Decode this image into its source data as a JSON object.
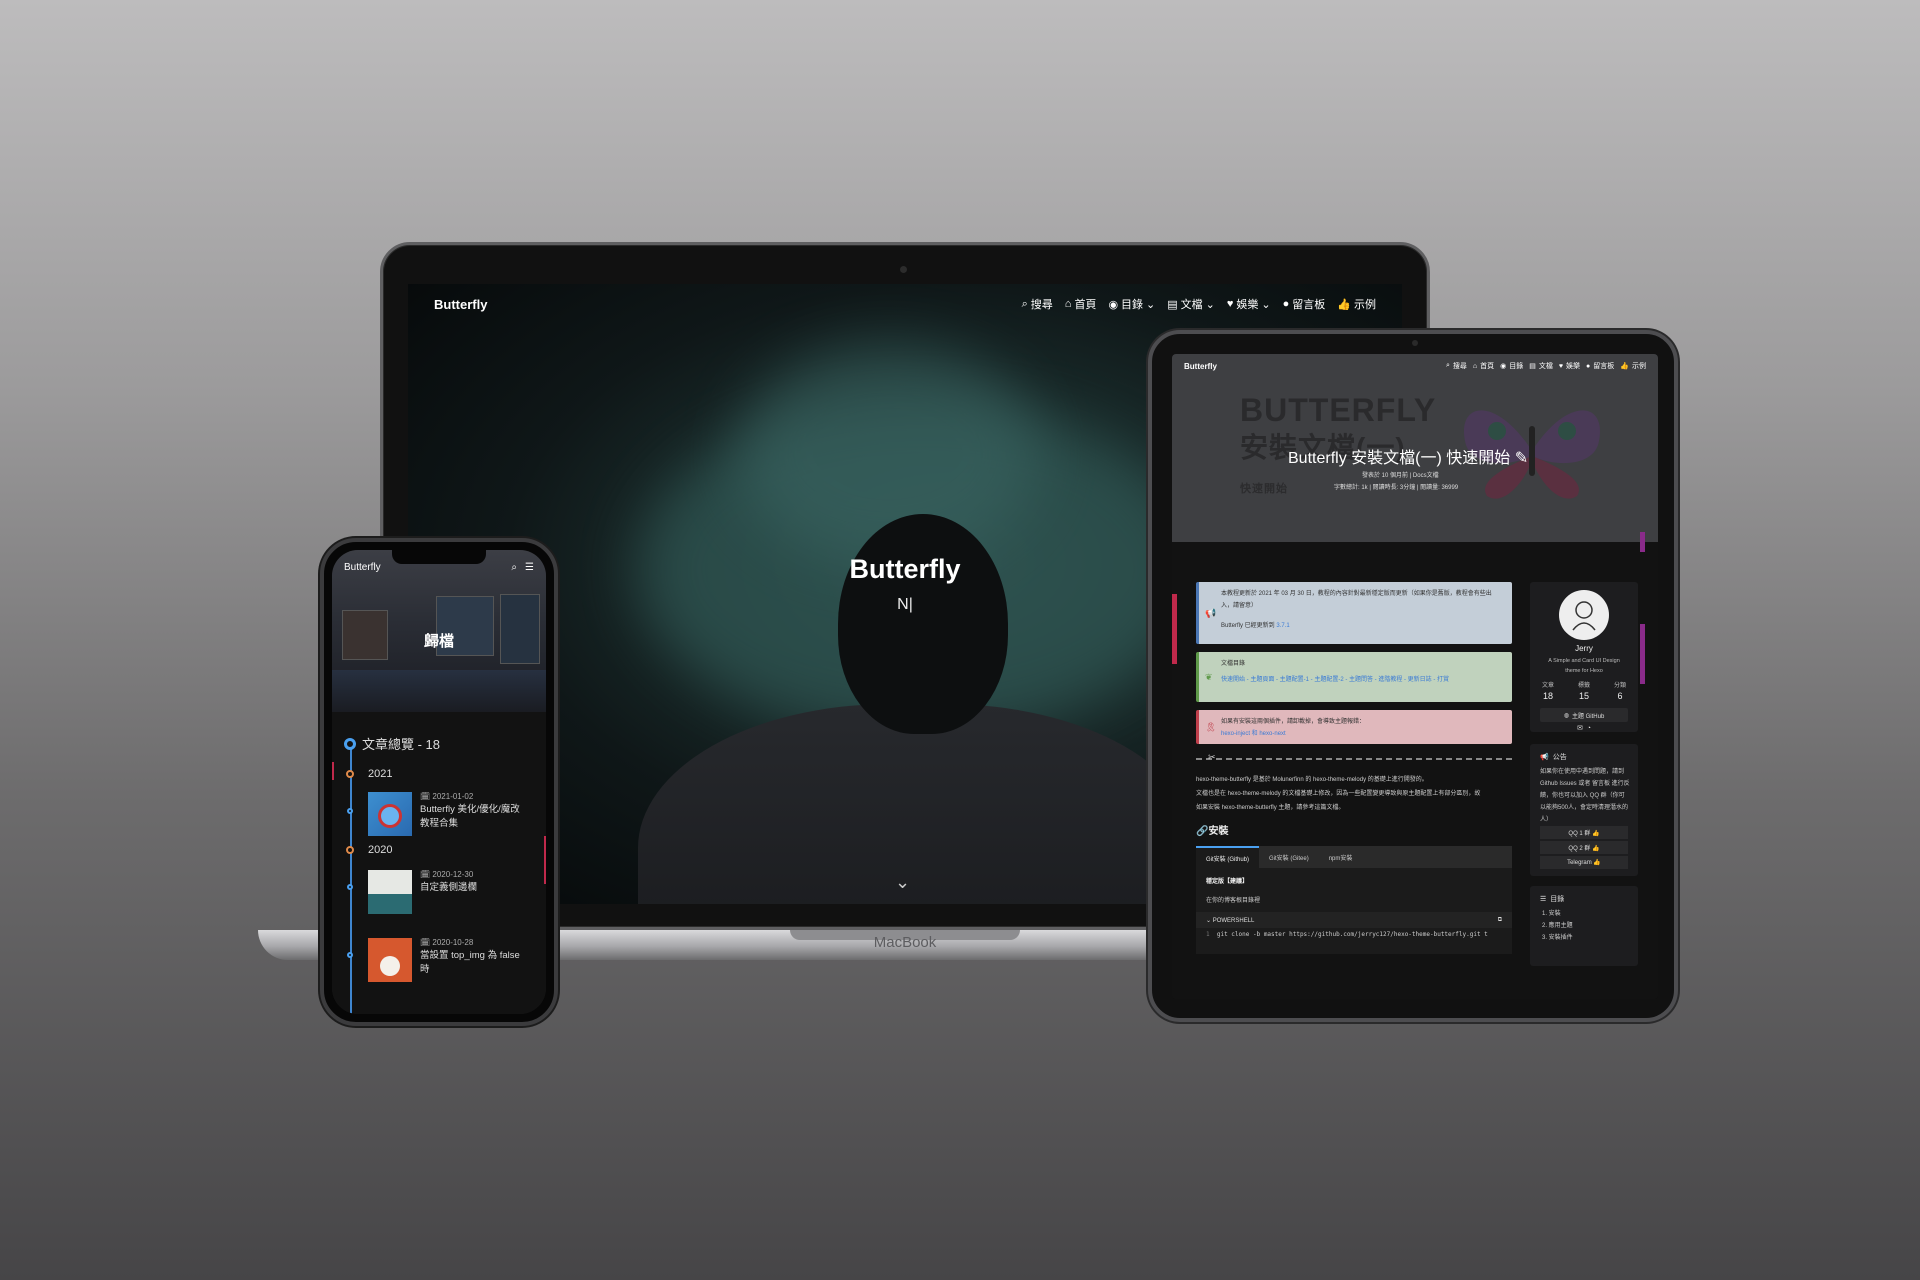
{
  "laptop": {
    "brand": "Butterfly",
    "nav": [
      {
        "icon": "search-icon",
        "glyph": "⌕",
        "label": "搜尋"
      },
      {
        "icon": "home-icon",
        "glyph": "⌂",
        "label": "首頁"
      },
      {
        "icon": "compass-icon",
        "glyph": "◉",
        "label": "目錄"
      },
      {
        "icon": "book-icon",
        "glyph": "▤",
        "label": "文檔"
      },
      {
        "icon": "heart-icon",
        "glyph": "♥",
        "label": "娛樂"
      },
      {
        "icon": "comment-icon",
        "glyph": "●",
        "label": "留言板"
      },
      {
        "icon": "thumbs-up-icon",
        "glyph": "👍",
        "label": "示例"
      }
    ],
    "site_title": "Butterfly",
    "subtitle": "N|",
    "base_label": "MacBook"
  },
  "phone": {
    "brand": "Butterfly",
    "page_title": "歸檔",
    "archive_header": "文章總覽 - 18",
    "years": [
      "2021",
      "2020"
    ],
    "posts": [
      {
        "date": "2021-01-02",
        "title": "Butterfly 美化/優化/魔改教程合集"
      },
      {
        "date": "2020-12-30",
        "title": "自定義側邊欄"
      },
      {
        "date": "2020-10-28",
        "title": "當設置 top_img 為 false 時"
      }
    ]
  },
  "tablet": {
    "brand": "Butterfly",
    "nav": [
      {
        "label": "搜尋"
      },
      {
        "label": "首頁"
      },
      {
        "label": "目錄"
      },
      {
        "label": "文檔"
      },
      {
        "label": "娛樂"
      },
      {
        "label": "留言板"
      },
      {
        "label": "示例"
      }
    ],
    "bg_title_1": "BUTTERFLY",
    "bg_title_2": "安裝文檔(一)",
    "bg_title_3": "快速開始",
    "post_title": "Butterfly 安裝文檔(一) 快速開始",
    "meta_1": "發表於 10 個月前 | Docs文檔",
    "meta_2": "字數總計: 1k | 閱讀時長: 3分鐘 | 閱讀量: 36999",
    "note_blue_1": "本教程更新於 2021 年 03 月 30 日，教程的內容針對最新穩定版而更新（如果你是舊版，教程會有些出入，請留意）",
    "note_blue_2": "Butterfly 已經更新到",
    "note_blue_version": "3.7.1",
    "note_green_head": "文檔目錄",
    "note_green_links": "快速開始 - 主題頁面 - 主題配置-1 - 主題配置-2 - 主題問答 - 進階教程 - 更新日誌 - 打賞",
    "note_red_1": "如果有安裝這兩個插件，請卸載掉，會導致主題報錯：",
    "note_red_2": "hexo-inject 和 hexo-next",
    "para_1": "hexo-theme-butterfly 是基於 Molunerfinn 的 hexo-theme-melody 的基礎上進行開發的。",
    "para_2": "文檔也是在 hexo-theme-melody 的文檔基礎上修改，因為一些配置變更導致與原主題配置上有部分區別，故",
    "para_3": "如果安裝 hexo-theme-butterfly 主題，請參考這篇文檔。",
    "install_heading": "安裝",
    "tabs": [
      "Git安裝 (Github)",
      "Git安裝 (Gitee)",
      "npm安裝"
    ],
    "stable_label": "穩定版【建議】",
    "stable_desc": "在你的博客根目錄裡",
    "code_lang": "POWERSHELL",
    "code_line_no": "1",
    "code": "git clone -b master https://github.com/jerryc127/hexo-theme-butterfly.git t",
    "author": "Jerry",
    "author_desc": "A Simple and Card UI Design theme for Hexo",
    "stats": [
      {
        "label": "文章",
        "value": "18"
      },
      {
        "label": "標籤",
        "value": "15"
      },
      {
        "label": "分類",
        "value": "6"
      }
    ],
    "github_btn": "主題 GitHub",
    "announcement_title": "公告",
    "announcement": "如果你在使用中遇到問題，請到 Github Issues 或者 留言板 進行反饋，你也可以加入 QQ 群（你可以能夠500人，會定時清理潛水的人）",
    "groups": [
      "QQ 1 群 👍",
      "QQ 2 群 👍",
      "Telegram 👍"
    ],
    "toc_title": "目錄",
    "toc": [
      "1. 安裝",
      "2. 應用主題",
      "3. 安裝插件"
    ],
    "colors": {
      "accent": "#4aa0f0",
      "note_blue": "#c4ced8",
      "note_green": "#c0d2bd",
      "note_red": "#e0b8bc"
    }
  }
}
